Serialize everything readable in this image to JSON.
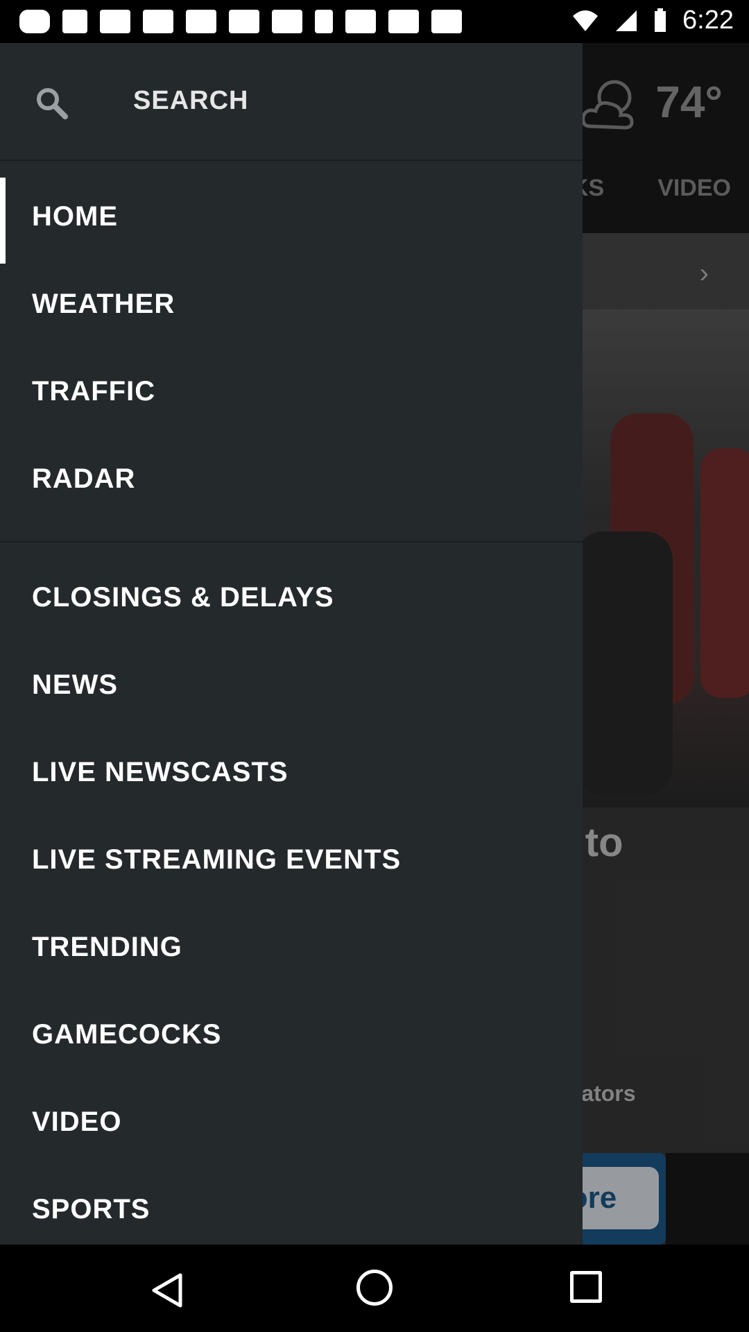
{
  "status_bar": {
    "time": "6:22",
    "icons": [
      "message-icon",
      "facebook-icon",
      "square-icon",
      "news-icon",
      "square-icon",
      "square-icon",
      "square-icon",
      "science-icon",
      "square-icon",
      "square-icon",
      "square-icon"
    ]
  },
  "background": {
    "weather_temp": "74°",
    "tab_partial": "KS",
    "tab_video": "VIDEO",
    "headline": "da to\nne",
    "snippet": "ks, Gators\nrth",
    "ad_text": "ore"
  },
  "drawer": {
    "search_label": "SEARCH",
    "items": [
      {
        "label": "HOME",
        "active": true
      },
      {
        "label": "WEATHER"
      },
      {
        "label": "TRAFFIC"
      },
      {
        "label": "RADAR"
      },
      {
        "label": "CLOSINGS & DELAYS"
      },
      {
        "label": "NEWS"
      },
      {
        "label": "LIVE NEWSCASTS"
      },
      {
        "label": "LIVE STREAMING EVENTS"
      },
      {
        "label": "TRENDING"
      },
      {
        "label": "GAMECOCKS"
      },
      {
        "label": "VIDEO"
      },
      {
        "label": "SPORTS"
      }
    ]
  },
  "colors": {
    "drawer_bg": "#24292c",
    "text": "#ffffff",
    "accent_active": "#ffffff"
  }
}
